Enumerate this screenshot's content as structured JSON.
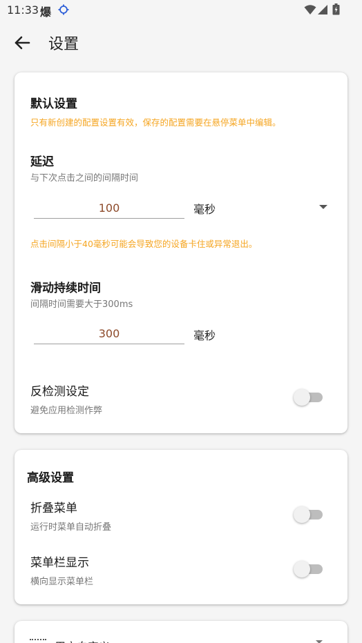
{
  "status_bar": {
    "time": "11:33",
    "notif_char": "爆",
    "icons": [
      "location-icon",
      "wifi-icon",
      "cell-signal-icon",
      "battery-icon"
    ]
  },
  "app_bar": {
    "title": "设置",
    "back_icon": "arrow-left-icon"
  },
  "default_settings": {
    "title": "默认设置",
    "warning": "只有新创建的配置设置有效，保存的配置需要在悬停菜单中编辑。",
    "delay": {
      "title": "延迟",
      "subtitle": "与下次点击之间的间隔时间",
      "value": "100",
      "unit": "毫秒",
      "warning": "点击间隔小于40毫秒可能会导致您的设备卡住或异常退出。"
    },
    "swipe_duration": {
      "title": "滑动持续时间",
      "subtitle": "间隔时间需要大于300ms",
      "value": "300",
      "unit": "毫秒"
    },
    "anti_detect": {
      "title": "反检测设定",
      "subtitle": "避免应用检测作弊",
      "enabled": false
    }
  },
  "advanced_settings": {
    "title": "高级设置",
    "collapse_menu": {
      "title": "折叠菜单",
      "subtitle": "运行时菜单自动折叠",
      "enabled": false
    },
    "menu_bar_display": {
      "title": "菜单栏显示",
      "subtitle": "横向显示菜单栏",
      "enabled": false
    }
  },
  "custom_section": {
    "title": "用户自定义"
  },
  "colors": {
    "warning": "#f5a623",
    "input_value": "#8d4a2a",
    "toggle_off_track": "#bdbdbd",
    "toggle_off_thumb": "#f1f1f1"
  }
}
